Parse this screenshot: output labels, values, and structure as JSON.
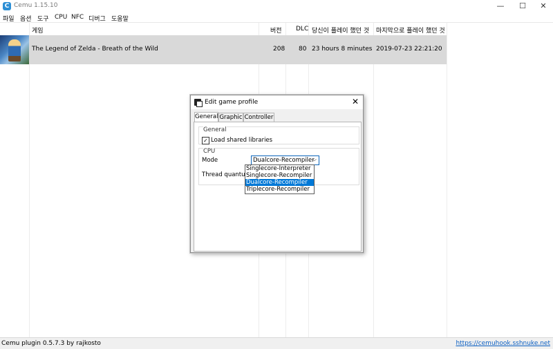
{
  "window": {
    "title": "Cemu 1.15.10",
    "icon_letter": "C",
    "minimize": "—",
    "maximize": "☐",
    "close": "✕"
  },
  "menu": [
    "파일",
    "옵션",
    "도구",
    "CPU",
    "NFC",
    "디버그",
    "도움말"
  ],
  "columns": {
    "game": "게임",
    "version": "버전",
    "dlc": "DLC",
    "playtime": "당신이 플레이 했던 것",
    "last_played": "마지막으로 플레이 했던 것"
  },
  "games": [
    {
      "title": "The Legend of Zelda - Breath of the Wild",
      "version": "208",
      "dlc": "80",
      "playtime": "23 hours 8 minutes",
      "last_played": "2019-07-23 22:21:20"
    }
  ],
  "statusbar": {
    "left": "Cemu plugin 0.5.7.3 by rajkosto",
    "right": "https://cemuhook.sshnuke.net"
  },
  "dialog": {
    "title": "Edit game profile",
    "close": "✕",
    "tabs": [
      "General",
      "Graphic",
      "Controller"
    ],
    "active_tab": "General",
    "general_group": {
      "label": "General",
      "load_shared_libraries": {
        "label": "Load shared libraries",
        "checked": true,
        "mark": "✓"
      }
    },
    "cpu_group": {
      "label": "CPU",
      "mode_label": "Mode",
      "mode_value": "Dualcore-Recompiler",
      "mode_arrow": "⌵",
      "thread_quantum_label": "Thread quantum",
      "mode_options": [
        "Singlecore-Interpreter",
        "Singlecore-Recompiler",
        "Dualcore-Recompiler",
        "Triplecore-Recompiler"
      ],
      "selected_option": "Dualcore-Recompiler"
    }
  }
}
